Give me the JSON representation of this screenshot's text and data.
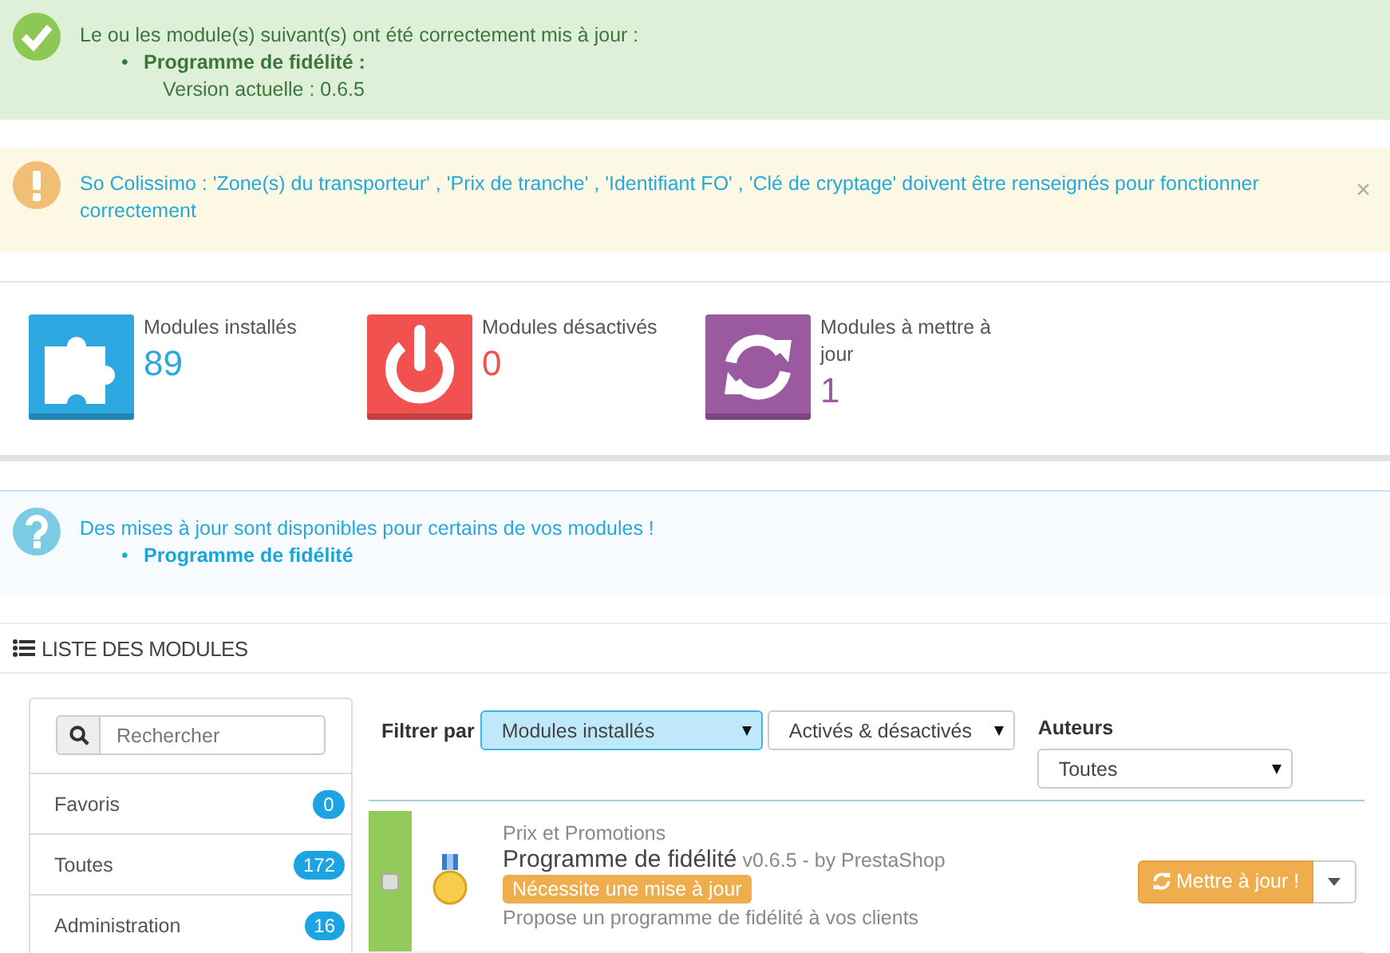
{
  "alerts": [
    {
      "kind": "success",
      "text": "Le ou les module(s) suivant(s) ont été correctement mis à jour :",
      "items": [
        {
          "bullet": "•",
          "name": "Programme de fidélité :",
          "detail": "Version actuelle : 0.6.5"
        }
      ]
    },
    {
      "kind": "warning",
      "text": "So Colissimo : 'Zone(s) du transporteur' , 'Prix de tranche' , 'Identifiant FO' , 'Clé de cryptage' doivent être renseignés pour fonctionner correctement",
      "close": "×"
    }
  ],
  "stats": [
    {
      "kind": "installed",
      "label": "Modules installés",
      "value": "89",
      "color": "#2ca7e0"
    },
    {
      "kind": "disabled",
      "label": "Modules désactivés",
      "value": "0",
      "color": "#f2524f"
    },
    {
      "kind": "update",
      "label": "Modules à mettre à jour",
      "value": "1",
      "color": "#9b59a0"
    }
  ],
  "info": {
    "text": "Des mises à jour sont disponibles pour certains de vos modules !",
    "items": [
      {
        "bullet": "•",
        "name": "Programme de fidélité"
      }
    ]
  },
  "module_list": {
    "title": "LISTE DES MODULES",
    "search": {
      "placeholder": "Rechercher"
    },
    "categories": [
      {
        "label": "Favoris",
        "count": "0"
      },
      {
        "label": "Toutes",
        "count": "172"
      },
      {
        "label": "Administration",
        "count": "16"
      }
    ],
    "filter": {
      "label": "Filtrer par",
      "selects": [
        {
          "value": "Modules installés",
          "focused": true
        },
        {
          "value": "Activés & désactivés",
          "focused": false
        }
      ]
    },
    "authors": {
      "label": "Auteurs",
      "value": "Toutes"
    },
    "modules": [
      {
        "category": "Prix et Promotions",
        "name": "Programme de fidélité",
        "version": "v0.6.5 - by PrestaShop",
        "badge": "Nécessite une mise à jour",
        "description": "Propose un programme de fidélité à vos clients",
        "checked": false,
        "action": "Mettre à jour !"
      }
    ]
  }
}
